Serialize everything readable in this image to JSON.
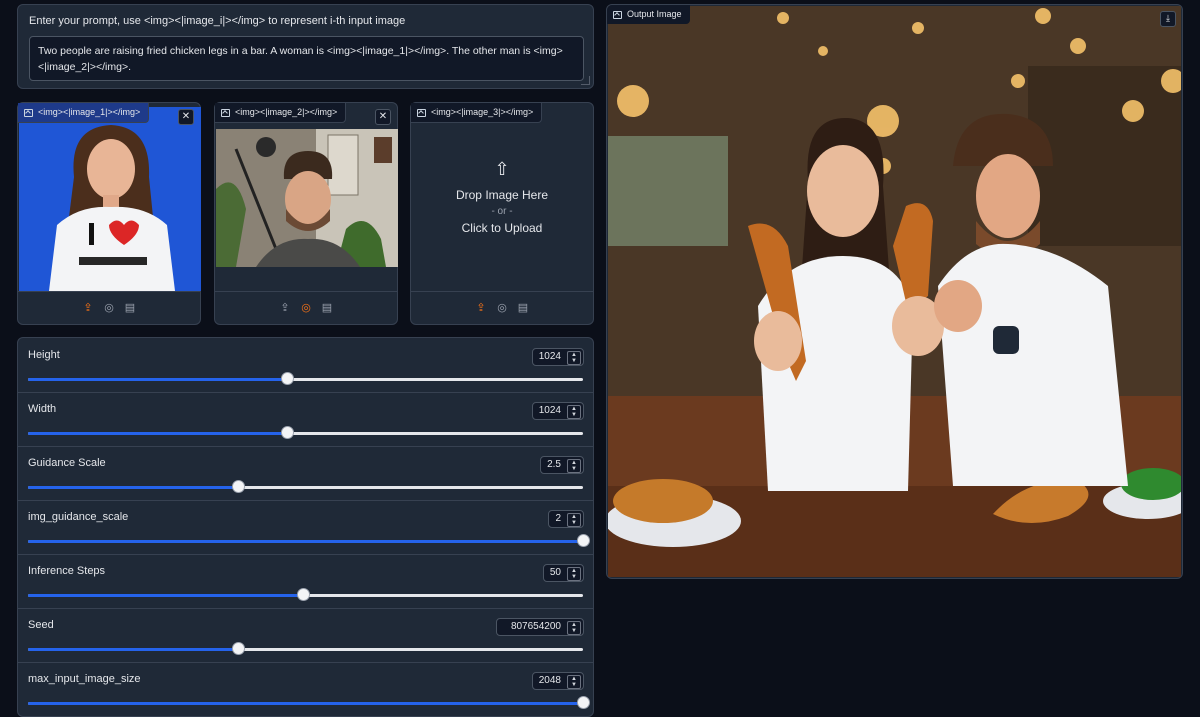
{
  "prompt": {
    "label": "Enter your prompt, use <img><|image_i|></img> to represent i-th input image",
    "value": "Two people are raising fried chicken legs in a bar. A woman is <img><|image_1|></img>. The other man is <img><|image_2|></img>."
  },
  "inputs": [
    {
      "label": "<img><|image_1|></img>",
      "has_image": true
    },
    {
      "label": "<img><|image_2|></img>",
      "has_image": true
    },
    {
      "label": "<img><|image_3|></img>",
      "has_image": false
    }
  ],
  "dropzone": {
    "drop_text": "Drop Image Here",
    "or_text": "- or -",
    "click_text": "Click to Upload"
  },
  "sliders": [
    {
      "label": "Height",
      "value": "1024",
      "fraction": 0.467
    },
    {
      "label": "Width",
      "value": "1024",
      "fraction": 0.467
    },
    {
      "label": "Guidance Scale",
      "value": "2.5",
      "fraction": 0.378
    },
    {
      "label": "img_guidance_scale",
      "value": "2",
      "fraction": 1.0
    },
    {
      "label": "Inference Steps",
      "value": "50",
      "fraction": 0.496
    },
    {
      "label": "Seed",
      "value": "807654200",
      "fraction": 0.378
    },
    {
      "label": "max_input_image_size",
      "value": "2048",
      "fraction": 1.0
    }
  ],
  "output": {
    "label": "Output Image"
  },
  "icons": {
    "upload": "upload-icon",
    "webcam": "webcam-icon",
    "clipboard": "clipboard-icon",
    "download": "download-icon",
    "close": "close-icon"
  },
  "colors": {
    "accent": "#2563eb",
    "active_icon": "#f97316",
    "background": "#0b0f19",
    "panel": "#1f2937"
  }
}
